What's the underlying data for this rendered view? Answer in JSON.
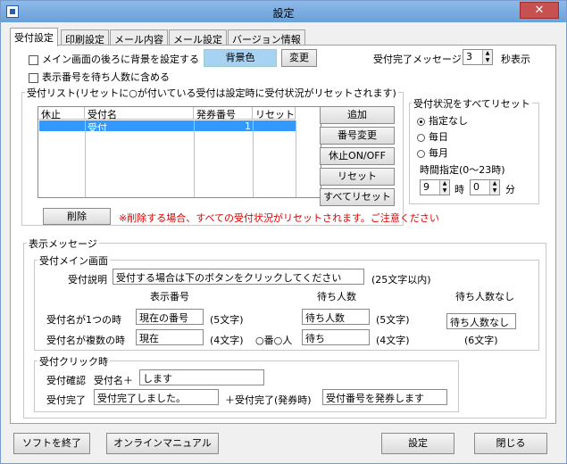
{
  "window": {
    "title": "設定",
    "close_glyph": "✕"
  },
  "tabs": [
    "受付設定",
    "印刷設定",
    "メール内容",
    "メール設定",
    "バージョン情報"
  ],
  "top": {
    "bg_checkbox_label": "メイン画面の後ろに背景を設定する",
    "bg_color_label": "背景色",
    "change_label": "変更",
    "show_wait_label": "表示番号を待ち人数に含める",
    "complete_msg_label": "受付完了メッセージ:",
    "complete_msg_value": "3",
    "seconds_label": "秒表示"
  },
  "list": {
    "group_title": "受付リスト(リセットに○が付いている受付は設定時に受付状況がリセットされます)",
    "headers": [
      "休止",
      "受付名",
      "発券番号",
      "リセット"
    ],
    "row": {
      "name": "受付",
      "number": "1"
    },
    "buttons": {
      "add": "追加",
      "renumber": "番号変更",
      "pause": "休止ON/OFF",
      "reset": "リセット",
      "reset_all": "すべてリセット"
    },
    "delete_label": "削除",
    "warning": "※削除する場合、すべての受付状況がリセットされます。ご注意ください"
  },
  "reset_all": {
    "title": "受付状況をすべてリセット",
    "options": [
      "指定なし",
      "毎日",
      "毎月"
    ],
    "time_label": "時間指定(0〜23時)",
    "hour_value": "9",
    "hour_unit": "時",
    "minute_value": "0",
    "minute_unit": "分"
  },
  "display": {
    "title": "表示メッセージ",
    "main_title": "受付メイン画面",
    "desc_label": "受付説明",
    "desc_value": "受付する場合は下のボタンをクリックしてください",
    "desc_limit": "(25文字以内)",
    "col_number": "表示番号",
    "col_wait": "待ち人数",
    "col_nowait": "待ち人数なし",
    "single_label": "受付名が1つの時",
    "single_number": "現在の番号",
    "single_number_limit": "(5文字)",
    "single_wait": "待ち人数",
    "single_wait_limit": "(5文字)",
    "nowait_value": "待ち人数なし",
    "nowait_limit": "(6文字)",
    "multi_label": "受付名が複数の時",
    "multi_number": "現在",
    "multi_number_limit": "(4文字)",
    "multi_mid": "○番○人",
    "multi_wait": "待ち",
    "multi_wait_limit": "(4文字)",
    "click_title": "受付クリック時",
    "confirm_label": "受付確認",
    "confirm_prefix": "受付名＋",
    "confirm_value": "します",
    "complete_label": "受付完了",
    "complete_value": "受付完了しました。",
    "complete_issue_label": "＋受付完了(発券時)",
    "complete_issue_value": "受付番号を発券します"
  },
  "bottom": {
    "quit": "ソフトを終了",
    "manual": "オンラインマニュアル",
    "apply": "設定",
    "close": "閉じる"
  }
}
